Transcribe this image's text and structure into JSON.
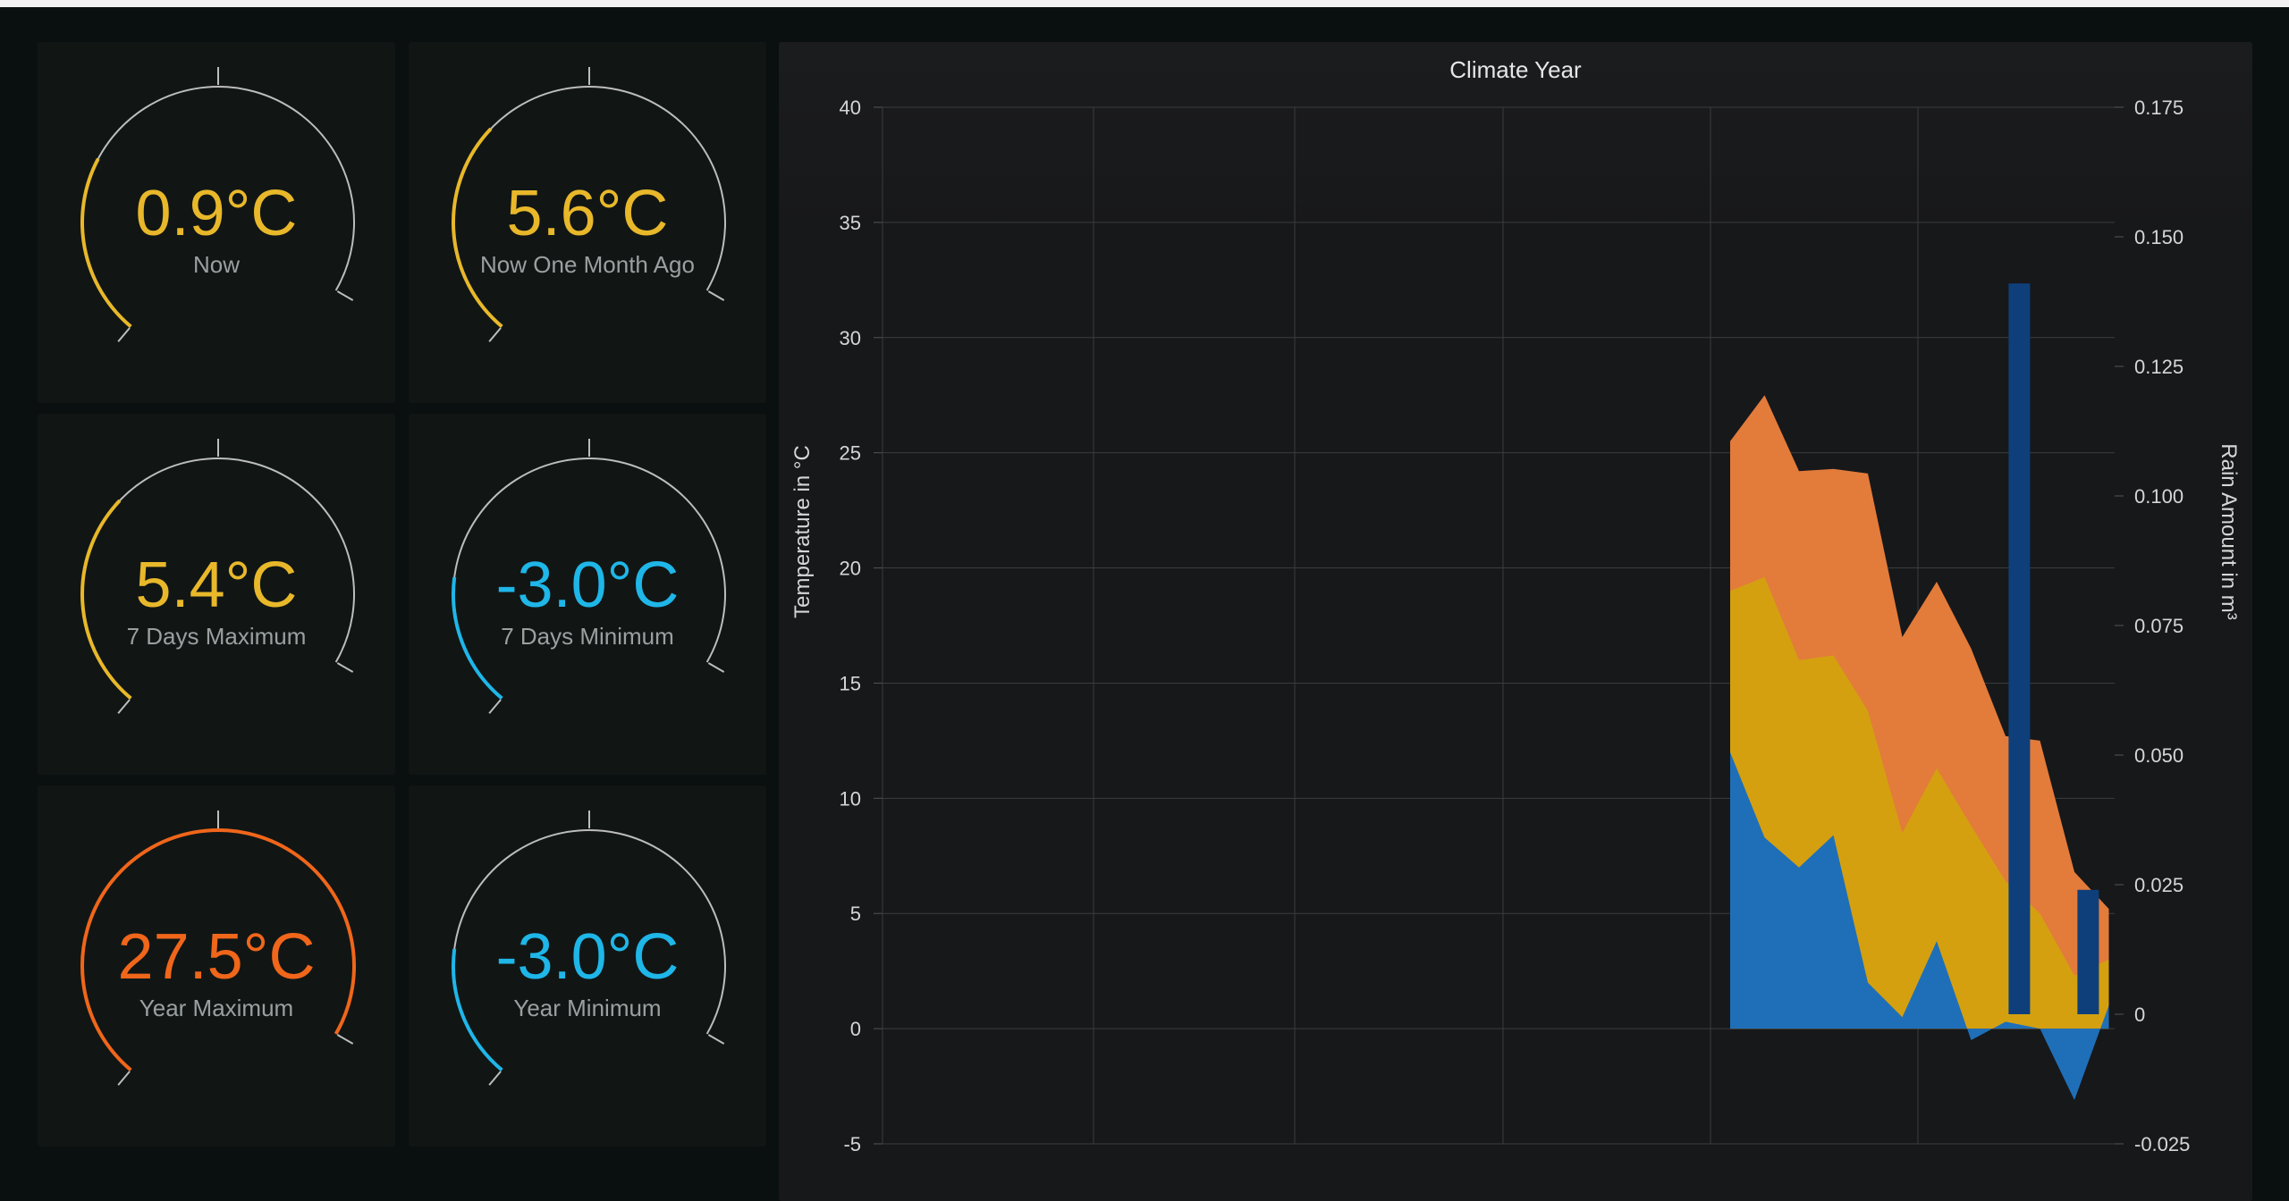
{
  "gauges": [
    {
      "value": "0.9°C",
      "label": "Now",
      "color": "#e8b82a",
      "fraction": 0.3
    },
    {
      "value": "5.6°C",
      "label": "Now One Month Ago",
      "color": "#e8b82a",
      "fraction": 0.36
    },
    {
      "value": "5.4°C",
      "label": "7 Days Maximum",
      "color": "#e8b82a",
      "fraction": 0.36
    },
    {
      "value": "-3.0°C",
      "label": "7 Days Minimum",
      "color": "#1fb6e8",
      "fraction": 0.22
    },
    {
      "value": "27.5°C",
      "label": "Year Maximum",
      "color": "#f0661a",
      "fraction": 1.0
    },
    {
      "value": "-3.0°C",
      "label": "Year Minimum",
      "color": "#1fb6e8",
      "fraction": 0.22
    }
  ],
  "chart_data": {
    "type": "area",
    "title": "Climate Year",
    "ylabel": "Temperature in °C",
    "y2label": "Rain Amount in m³",
    "ylim": [
      -5,
      40
    ],
    "y2lim": [
      -0.025,
      0.175
    ],
    "yticks": [
      "-5",
      "0",
      "5",
      "10",
      "15",
      "20",
      "25",
      "30",
      "35",
      "40"
    ],
    "y2ticks": [
      "-0.025",
      "0",
      "0.025",
      "0.050",
      "0.075",
      "0.100",
      "0.125",
      "0.150",
      "0.175"
    ],
    "x": [
      0,
      1,
      2,
      3,
      4,
      5,
      6,
      7,
      8,
      9,
      10,
      11
    ],
    "series": [
      {
        "values": [
          25.5,
          27.5,
          24.2,
          24.3,
          24.1,
          17.0,
          19.4,
          16.5,
          12.7,
          12.5,
          6.8,
          5.2
        ],
        "color": "#e37b3b"
      },
      {
        "values": [
          19.0,
          19.6,
          16.0,
          16.2,
          13.8,
          8.5,
          11.3,
          8.8,
          6.4,
          5.0,
          2.3,
          3.0
        ],
        "color": "#d4a010"
      },
      {
        "values": [
          12.0,
          8.3,
          7.0,
          8.4,
          2.0,
          0.5,
          3.8,
          -0.5,
          0.3,
          0.0,
          -3.1,
          1.0
        ],
        "color": "#1f6fb8"
      }
    ],
    "bars": [
      {
        "x": 8.4,
        "value": 0.141,
        "color": "#0e3f7a"
      },
      {
        "x": 10.4,
        "value": 0.024,
        "color": "#0e3f7a"
      }
    ],
    "grid": true
  }
}
